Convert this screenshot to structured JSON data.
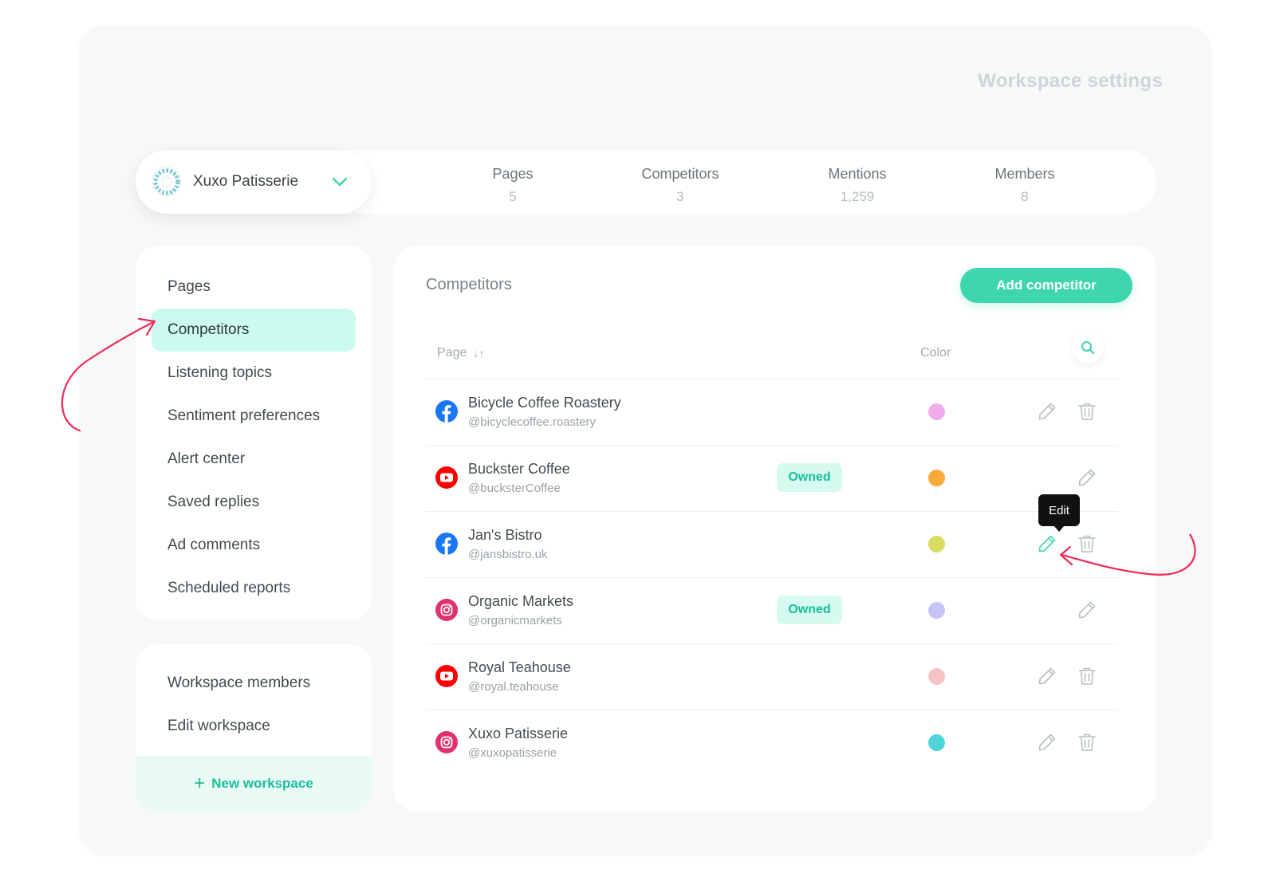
{
  "page_title": "Workspace settings",
  "workspace": {
    "name": "Xuxo Patisserie"
  },
  "stats": [
    {
      "label": "Pages",
      "value": "5"
    },
    {
      "label": "Competitors",
      "value": "3"
    },
    {
      "label": "Mentions",
      "value": "1,259"
    },
    {
      "label": "Members",
      "value": "8"
    }
  ],
  "sidebar": {
    "items": [
      {
        "label": "Pages",
        "active": false
      },
      {
        "label": "Competitors",
        "active": true
      },
      {
        "label": "Listening topics",
        "active": false
      },
      {
        "label": "Sentiment preferences",
        "active": false
      },
      {
        "label": "Alert center",
        "active": false
      },
      {
        "label": "Saved replies",
        "active": false
      },
      {
        "label": "Ad comments",
        "active": false
      },
      {
        "label": "Scheduled reports",
        "active": false
      }
    ],
    "secondary": [
      {
        "label": "Workspace members"
      },
      {
        "label": "Edit workspace"
      }
    ],
    "new_workspace_label": "New workspace",
    "new_workspace_icon": "+"
  },
  "main": {
    "title": "Competitors",
    "add_button": "Add competitor",
    "col_page": "Page",
    "col_page_sort_icon": "↓↑",
    "col_color": "Color",
    "owned_label": "Owned",
    "tooltip": "Edit",
    "accent": "#3ed6ae",
    "rows": [
      {
        "network": "facebook",
        "name": "Bicycle Coffee Roastery",
        "handle": "@bicyclecoffee.roastery",
        "owned": false,
        "color": "#f0abea",
        "deletable": true
      },
      {
        "network": "youtube",
        "name": "Buckster Coffee",
        "handle": "@bucksterCoffee",
        "owned": true,
        "color": "#f7a93a",
        "deletable": false
      },
      {
        "network": "facebook",
        "name": "Jan's Bistro",
        "handle": "@jansbistro.uk",
        "owned": false,
        "color": "#d9dc63",
        "deletable": true,
        "hovered": true
      },
      {
        "network": "instagram",
        "name": "Organic Markets",
        "handle": "@organicmarkets",
        "owned": true,
        "color": "#c6c3f7",
        "deletable": false
      },
      {
        "network": "youtube",
        "name": "Royal Teahouse",
        "handle": "@royal.teahouse",
        "owned": false,
        "color": "#f5c3c3",
        "deletable": true
      },
      {
        "network": "instagram",
        "name": "Xuxo Patisserie",
        "handle": "@xuxopatisserie",
        "owned": false,
        "color": "#4fd5d8",
        "deletable": true
      }
    ]
  }
}
